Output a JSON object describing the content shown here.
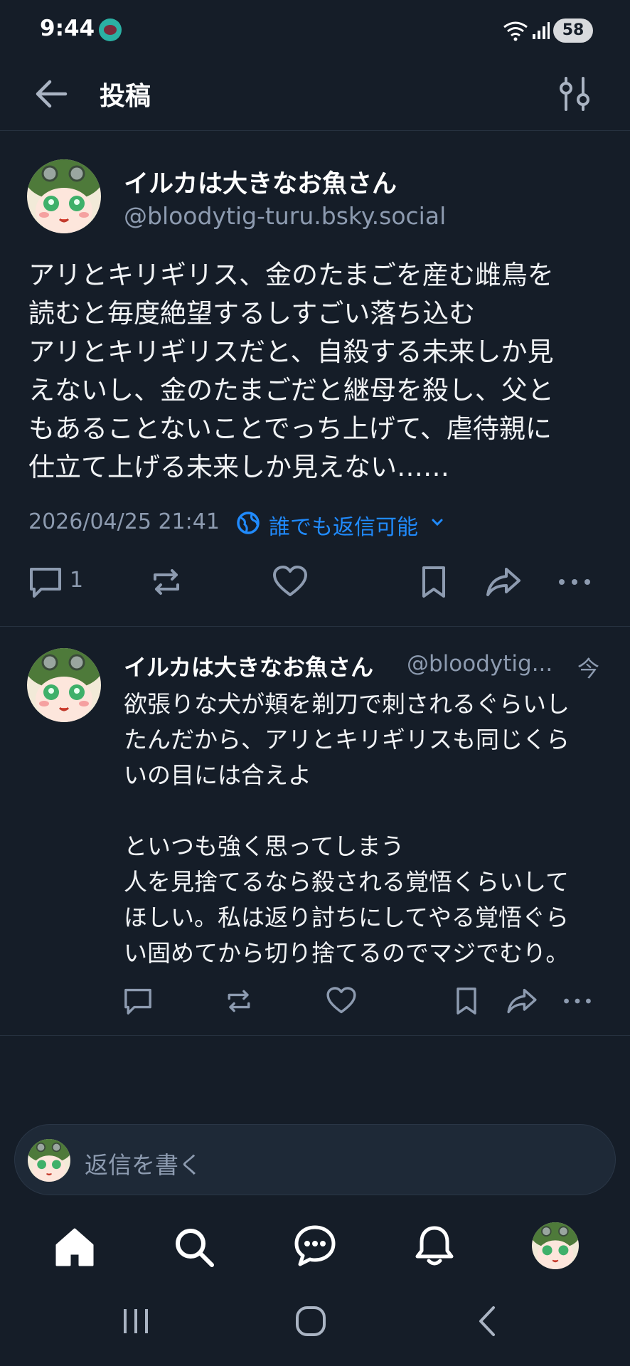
{
  "status": {
    "time": "9:44",
    "battery": "58"
  },
  "header": {
    "title": "投稿"
  },
  "main_post": {
    "display_name": "イルカは大きなお魚さん",
    "handle": "@bloodytig-turu.bsky.social",
    "text": "アリとキリギリス、金のたまごを産む雌鳥を\n読むと毎度絶望するしすごい落ち込む\nアリとキリギリスだと、自殺する未来しか見\nえないし、金のたまごだと継母を殺し、父と\nもあることないことでっち上げて、虐待親に\n仕立て上げる未来しか見えない……",
    "timestamp": "2026/04/25 21:41",
    "reply_setting": "誰でも返信可能",
    "reply_count": "1"
  },
  "reply_post": {
    "display_name": "イルカは大きなお魚さん",
    "handle": "@bloodytig...",
    "time": "今",
    "text": "欲張りな犬が頬を剃刀で刺されるぐらいし\nたんだから、アリとキリギリスも同じくら\nいの目には合えよ\n\nといつも強く思ってしまう\n人を見捨てるなら殺される覚悟くらいして\nほしい。私は返り討ちにしてやる覚悟ぐら\nい固めてから切り捨てるのでマジでむり。"
  },
  "compose": {
    "placeholder": "返信を書く"
  },
  "icons": {
    "back": "arrow-left-icon",
    "filter": "sliders-icon",
    "reply": "comment-icon",
    "repost": "repost-icon",
    "like": "heart-icon",
    "bookmark": "bookmark-icon",
    "share": "share-icon",
    "more": "ellipsis-icon",
    "globe": "globe-icon",
    "home": "home-icon",
    "search": "search-icon",
    "chat": "chat-icon",
    "bell": "bell-icon"
  },
  "colors": {
    "background": "#151d28",
    "accent": "#208bfe",
    "muted": "#8d9bb0"
  }
}
